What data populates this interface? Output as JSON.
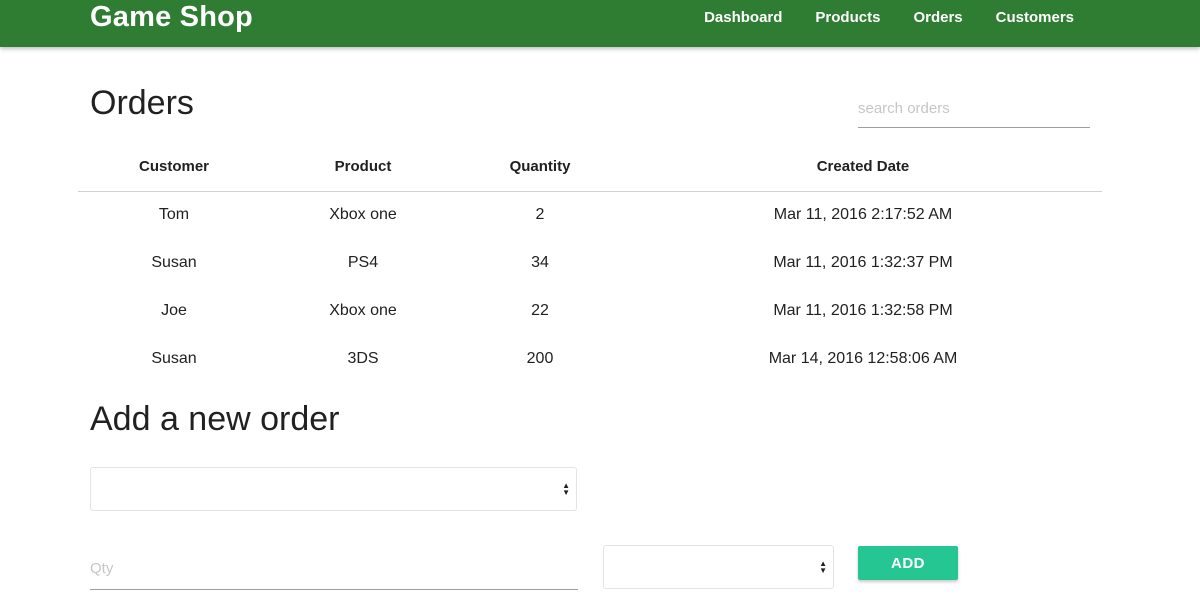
{
  "navbar": {
    "brand": "Game Shop",
    "links": [
      "Dashboard",
      "Products",
      "Orders",
      "Customers"
    ],
    "color": "#2e7d32"
  },
  "orders": {
    "title": "Orders",
    "search_placeholder": "search orders",
    "columns": [
      "Customer",
      "Product",
      "Quantity",
      "Created Date"
    ],
    "rows": [
      [
        "Tom",
        "Xbox one",
        "2",
        "Mar 11, 2016 2:17:52 AM"
      ],
      [
        "Susan",
        "PS4",
        "34",
        "Mar 11, 2016 1:32:37 PM"
      ],
      [
        "Joe",
        "Xbox one",
        "22",
        "Mar 11, 2016 1:32:58 PM"
      ],
      [
        "Susan",
        "3DS",
        "200",
        "Mar 14, 2016 12:58:06 AM"
      ]
    ]
  },
  "new_order": {
    "title": "Add a new order",
    "customer_select_value": "",
    "qty_placeholder": "Qty",
    "product_select_value": "",
    "add_label": "ADD",
    "add_color": "#26c693"
  }
}
